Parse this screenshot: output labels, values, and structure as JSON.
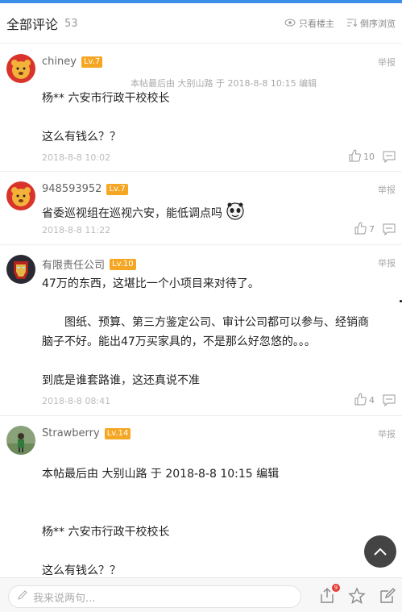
{
  "header": {
    "title": "全部评论",
    "count": "53",
    "only_author_label": "只看楼主",
    "reverse_order_label": "倒序浏览"
  },
  "comments": [
    {
      "username": "chiney",
      "level": "Lv.7",
      "report": "举报",
      "edit_note": "本帖最后由 大别山路 于 2018-8-8 10:15 编辑",
      "lines": [
        "杨** 六安市行政干校校长",
        "这么有钱么？？"
      ],
      "time": "2018-8-8 10:02",
      "likes": "10",
      "avatar_icon": "cartoon-bear-avatar"
    },
    {
      "username": "948593952",
      "level": "Lv.7",
      "report": "举报",
      "lines": [
        "省委巡视组在巡视六安，能低调点吗"
      ],
      "time": "2018-8-8 11:22",
      "likes": "7",
      "avatar_icon": "cartoon-bear-avatar"
    },
    {
      "username": "有限责任公司",
      "level": "Lv.10",
      "report": "举报",
      "lines": [
        "47万的东西，这堪比一个小项目来对待了。",
        "图纸、预算、第三方鉴定公司、审计公司都可以参与、经销商",
        "脑子不好。能出47万买家具的，不是那么好忽悠的。。。",
        "到底是谁套路谁，这还真说不准"
      ],
      "time": "2018-8-8 08:41",
      "likes": "4",
      "avatar_icon": "ironman-avatar"
    },
    {
      "username": "Strawberry",
      "level": "Lv.14",
      "report": "举报",
      "lines": [
        "本帖最后由 大别山路 于 2018-8-8 10:15 编辑",
        "杨** 六安市行政干校校长",
        "这么有钱么？？"
      ],
      "avatar_icon": "photo-avatar"
    }
  ],
  "bottom_bar": {
    "reply_placeholder": "我来说两句...",
    "share_badge": "9"
  },
  "colors": {
    "accent": "#3b8fe6",
    "level_badge": "#f5a623",
    "notification": "#e53935"
  }
}
